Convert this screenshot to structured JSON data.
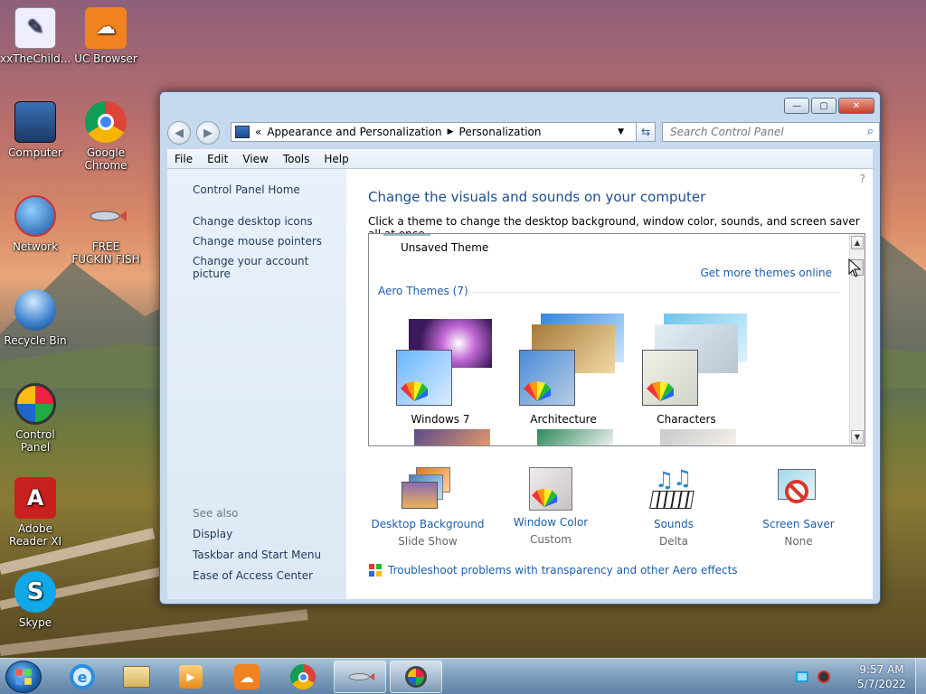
{
  "desktop": {
    "icons": [
      {
        "label": "xxTheChild...",
        "icon": "file-icon"
      },
      {
        "label": "UC Browser",
        "icon": "uc-browser-icon"
      },
      {
        "label": "Computer",
        "icon": "computer-icon"
      },
      {
        "label": "Google Chrome",
        "icon": "chrome-icon"
      },
      {
        "label": "Network",
        "icon": "network-icon"
      },
      {
        "label": "FREE FUCKIN FISH",
        "icon": "fish-icon"
      },
      {
        "label": "Recycle Bin",
        "icon": "recycle-bin-icon"
      },
      {
        "label": "Control Panel",
        "icon": "control-panel-icon"
      },
      {
        "label": "Adobe Reader XI",
        "icon": "adobe-reader-icon"
      },
      {
        "label": "Skype",
        "icon": "skype-icon"
      }
    ]
  },
  "window": {
    "caption": {
      "minimize": "—",
      "maximize": "▢",
      "close": "✕"
    },
    "nav": {
      "back": "◀",
      "forward": "▶"
    },
    "address": {
      "prefix": "«",
      "crumbs": [
        "Appearance and Personalization",
        "Personalization"
      ]
    },
    "search_placeholder": "Search Control Panel",
    "menu": [
      "File",
      "Edit",
      "View",
      "Tools",
      "Help"
    ],
    "side": {
      "home": "Control Panel Home",
      "links": [
        "Change desktop icons",
        "Change mouse pointers",
        "Change your account picture"
      ],
      "see_also": "See also",
      "see_also_links": [
        "Display",
        "Taskbar and Start Menu",
        "Ease of Access Center"
      ]
    },
    "content": {
      "title": "Change the visuals and sounds on your computer",
      "subtitle": "Click a theme to change the desktop background, window color, sounds, and screen saver all at once.",
      "unsaved_theme": "Unsaved Theme",
      "get_more": "Get more themes online",
      "aero_header": "Aero Themes (7)",
      "themes": [
        "Windows 7",
        "Architecture",
        "Characters"
      ],
      "tools": [
        {
          "label": "Desktop Background",
          "value": "Slide Show"
        },
        {
          "label": "Window Color",
          "value": "Custom"
        },
        {
          "label": "Sounds",
          "value": "Delta"
        },
        {
          "label": "Screen Saver",
          "value": "None"
        }
      ],
      "troubleshoot": "Troubleshoot problems with transparency and other Aero effects"
    }
  },
  "taskbar": {
    "time": "9:57 AM",
    "date": "5/7/2022"
  }
}
